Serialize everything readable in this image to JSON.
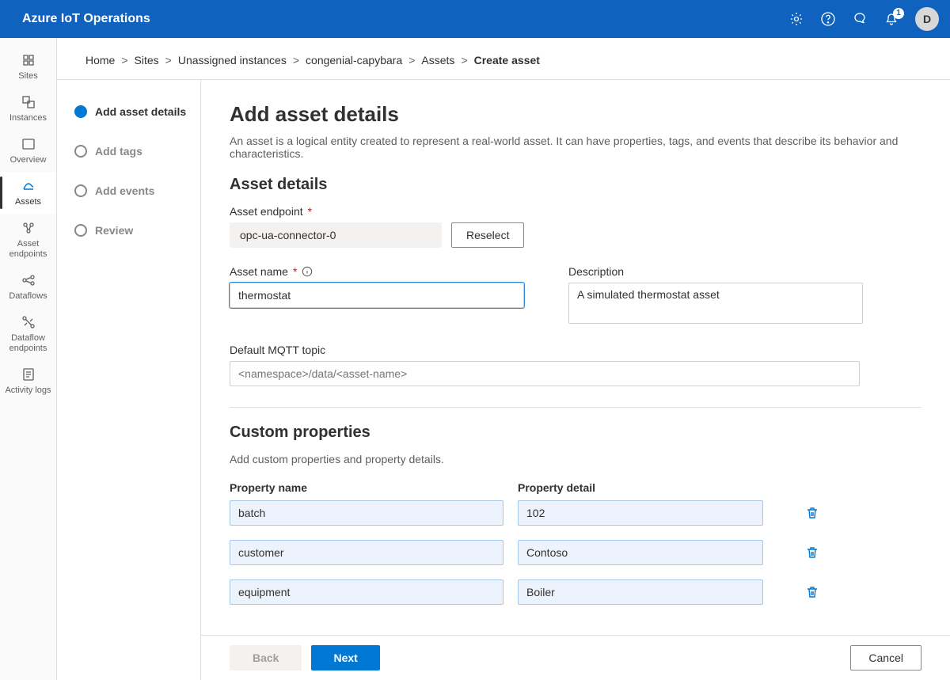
{
  "header": {
    "brand": "Azure IoT Operations",
    "notification_count": "1",
    "avatar_initial": "D"
  },
  "sidebar": {
    "items": [
      {
        "id": "sites",
        "label": "Sites"
      },
      {
        "id": "instances",
        "label": "Instances"
      },
      {
        "id": "overview",
        "label": "Overview"
      },
      {
        "id": "assets",
        "label": "Assets"
      },
      {
        "id": "asset-endpoints",
        "label": "Asset endpoints"
      },
      {
        "id": "dataflows",
        "label": "Dataflows"
      },
      {
        "id": "dataflow-endpoints",
        "label": "Dataflow endpoints"
      },
      {
        "id": "activity-logs",
        "label": "Activity logs"
      }
    ],
    "active_id": "assets"
  },
  "breadcrumb": {
    "items": [
      "Home",
      "Sites",
      "Unassigned instances",
      "congenial-capybara",
      "Assets"
    ],
    "current": "Create asset"
  },
  "wizard": {
    "steps": [
      "Add asset details",
      "Add tags",
      "Add events",
      "Review"
    ],
    "current_index": 0
  },
  "form": {
    "page_title": "Add asset details",
    "intro": "An asset is a logical entity created to represent a real-world asset. It can have properties, tags, and events that describe its behavior and characteristics.",
    "section_asset_details": "Asset details",
    "labels": {
      "asset_endpoint": "Asset endpoint",
      "reselect": "Reselect",
      "asset_name": "Asset name",
      "description": "Description",
      "default_mqtt": "Default MQTT topic"
    },
    "values": {
      "asset_endpoint": "opc-ua-connector-0",
      "asset_name": "thermostat",
      "description": "A simulated thermostat asset",
      "mqtt_placeholder": "<namespace>/data/<asset-name>"
    },
    "custom_properties": {
      "title": "Custom properties",
      "subtitle": "Add custom properties and property details.",
      "header_name": "Property name",
      "header_detail": "Property detail",
      "rows": [
        {
          "name": "batch",
          "detail": "102"
        },
        {
          "name": "customer",
          "detail": "Contoso"
        },
        {
          "name": "equipment",
          "detail": "Boiler"
        }
      ]
    }
  },
  "footer": {
    "back": "Back",
    "next": "Next",
    "cancel": "Cancel"
  }
}
